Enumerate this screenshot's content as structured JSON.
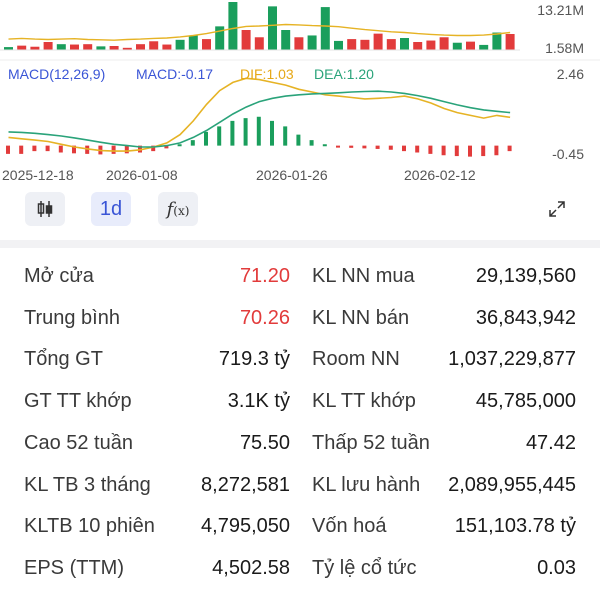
{
  "chart": {
    "volume_axis": {
      "top": "13.21M",
      "bottom": "1.58M"
    },
    "macd_axis": {
      "top": "2.46",
      "bottom": "-0.45"
    },
    "macd_header": {
      "macd_title": "MACD(12,26,9)",
      "macd_value": "MACD:-0.17",
      "dif_value": "DIF:1.03",
      "dea_value": "DEA:1.20"
    },
    "dates": [
      "2025-12-18",
      "2026-01-08",
      "2026-01-26",
      "2026-02-12"
    ],
    "colors": {
      "up": "#1a9e5c",
      "down": "#e23b3b",
      "dif": "#e6b325",
      "dea": "#2aa37a",
      "value_red": "#e23b3b"
    }
  },
  "chart_data": {
    "type": "bar",
    "volume": {
      "colors": [
        "g",
        "r",
        "r",
        "r",
        "g",
        "r",
        "r",
        "g",
        "r",
        "r",
        "r",
        "r",
        "r",
        "g",
        "g",
        "r",
        "g",
        "g",
        "r",
        "r",
        "g",
        "g",
        "r",
        "g",
        "g",
        "g",
        "r",
        "r",
        "r",
        "r",
        "g",
        "r",
        "r",
        "r",
        "g",
        "r",
        "g",
        "g",
        "r"
      ],
      "values": [
        0.8,
        1.2,
        0.9,
        2.2,
        1.6,
        1.5,
        1.6,
        1.0,
        1.1,
        0.6,
        1.6,
        2.4,
        1.5,
        2.8,
        4.0,
        3.0,
        6.5,
        13.2,
        5.5,
        3.5,
        12.0,
        5.5,
        3.5,
        4.0,
        11.8,
        2.5,
        3.0,
        2.8,
        4.5,
        3.0,
        3.3,
        2.2,
        2.6,
        3.5,
        2.0,
        2.3,
        1.4,
        4.8,
        4.4
      ]
    },
    "price_ma": [
      3.0,
      3.2,
      3.0,
      2.9,
      3.0,
      3.1,
      2.9,
      2.8,
      2.7,
      2.9,
      3.0,
      3.2,
      3.3,
      3.6,
      4.0,
      4.5,
      5.2,
      5.9,
      6.5,
      6.6,
      6.8,
      7.0,
      6.9,
      6.7,
      6.6,
      6.4,
      6.0,
      5.6,
      5.3,
      5.0,
      4.8,
      4.5,
      4.3,
      4.1,
      4.0,
      4.0,
      4.1,
      4.4,
      4.8
    ],
    "macd_hist": [
      -0.3,
      -0.3,
      -0.2,
      -0.2,
      -0.25,
      -0.28,
      -0.3,
      -0.32,
      -0.3,
      -0.28,
      -0.25,
      -0.2,
      -0.1,
      0.05,
      0.2,
      0.5,
      0.7,
      0.9,
      1.0,
      1.05,
      0.9,
      0.7,
      0.4,
      0.2,
      0.05,
      -0.05,
      -0.08,
      -0.1,
      -0.12,
      -0.15,
      -0.2,
      -0.25,
      -0.3,
      -0.35,
      -0.38,
      -0.4,
      -0.38,
      -0.35,
      -0.2
    ],
    "dif": [
      0.3,
      0.25,
      0.2,
      0.15,
      0.05,
      -0.05,
      -0.12,
      -0.18,
      -0.2,
      -0.2,
      -0.15,
      -0.05,
      0.1,
      0.4,
      0.9,
      1.5,
      2.0,
      2.3,
      2.45,
      2.4,
      2.3,
      2.2,
      2.05,
      1.95,
      1.85,
      1.8,
      1.75,
      1.7,
      1.72,
      1.75,
      1.8,
      1.7,
      1.55,
      1.35,
      1.2,
      1.1,
      1.0,
      1.1,
      1.03
    ],
    "dea": [
      0.5,
      0.48,
      0.45,
      0.4,
      0.35,
      0.28,
      0.2,
      0.12,
      0.05,
      0.0,
      -0.05,
      -0.05,
      0.0,
      0.1,
      0.3,
      0.55,
      0.85,
      1.15,
      1.4,
      1.6,
      1.72,
      1.8,
      1.85,
      1.88,
      1.9,
      1.92,
      1.95,
      1.97,
      1.98,
      1.95,
      1.9,
      1.82,
      1.72,
      1.6,
      1.48,
      1.38,
      1.3,
      1.25,
      1.2
    ],
    "macd_range": [
      -0.45,
      2.46
    ]
  },
  "toolbar": {
    "candle_icon": "candlestick-icon",
    "interval_label": "1d",
    "indicator_icon": "function-icon",
    "expand_icon": "expand-icon"
  },
  "stats": [
    {
      "left_label": "Mở cửa",
      "left_value": "71.20",
      "left_red": true,
      "right_label": "KL NN mua",
      "right_value": "29,139,560"
    },
    {
      "left_label": "Trung bình",
      "left_value": "70.26",
      "left_red": true,
      "right_label": "KL NN bán",
      "right_value": "36,843,942"
    },
    {
      "left_label": "Tổng GT",
      "left_value": "719.3 tỷ",
      "left_red": false,
      "right_label": "Room NN",
      "right_value": "1,037,229,877"
    },
    {
      "left_label": "GT TT khớp",
      "left_value": "3.1K tỷ",
      "left_red": false,
      "right_label": "KL TT khớp",
      "right_value": "45,785,000"
    },
    {
      "left_label": "Cao 52 tuần",
      "left_value": "75.50",
      "left_red": false,
      "right_label": "Thấp 52 tuần",
      "right_value": "47.42"
    },
    {
      "left_label": "KL TB 3 tháng",
      "left_value": "8,272,581",
      "left_red": false,
      "right_label": "KL lưu hành",
      "right_value": "2,089,955,445"
    },
    {
      "left_label": "KLTB 10 phiên",
      "left_value": "4,795,050",
      "left_red": false,
      "right_label": "Vốn hoá",
      "right_value": "151,103.78 tỷ"
    },
    {
      "left_label": "EPS (TTM)",
      "left_value": "4,502.58",
      "left_red": false,
      "right_label": "Tỷ lệ cổ tức",
      "right_value": "0.03"
    }
  ]
}
